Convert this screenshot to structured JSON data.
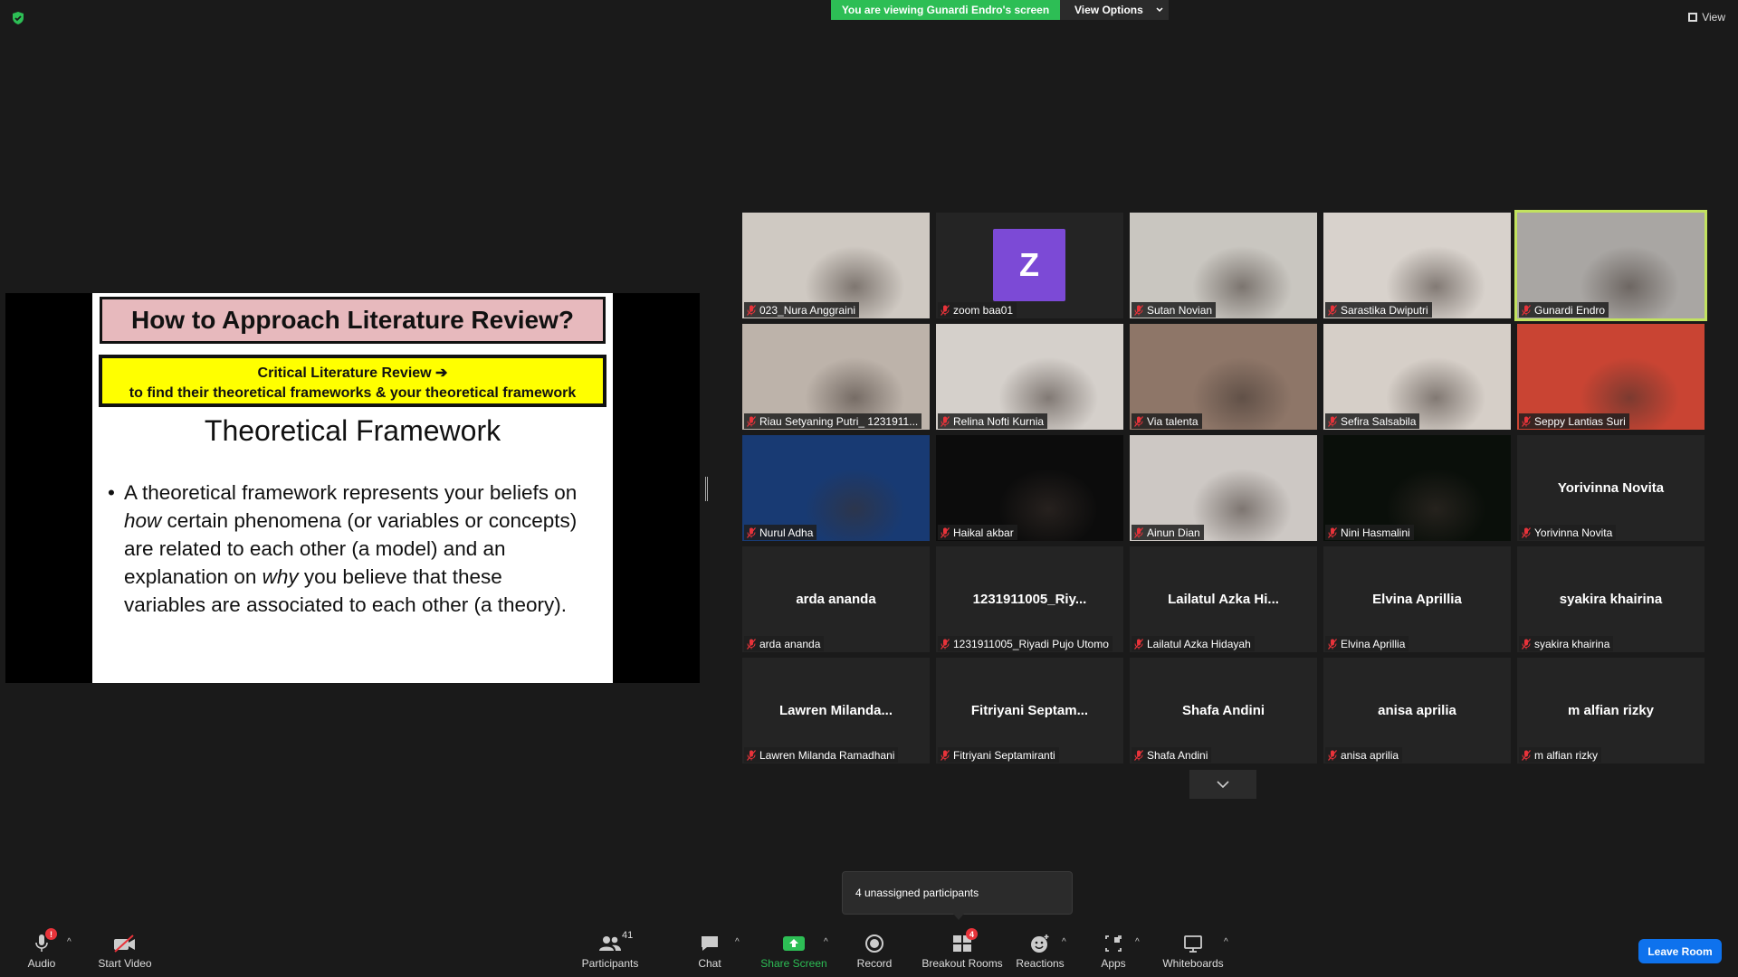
{
  "banner": {
    "viewing_text": "You are viewing Gunardi Endro's screen",
    "view_options": "View Options",
    "view_label": "View"
  },
  "slide": {
    "title": "How to Approach Literature Review?",
    "box_line1": "Critical Literature Review ➔",
    "box_line2": "to find their theoretical frameworks & your theoretical framework",
    "subtitle": "Theoretical Framework",
    "bullet_part1": "A theoretical framework represents your beliefs on ",
    "bullet_em1": "how",
    "bullet_part2": " certain phenomena (or variables or concepts) are related to each other (a model) and an explanation on ",
    "bullet_em2": "why",
    "bullet_part3": " you believe that these variables are associated to each other (a theory)."
  },
  "participants": [
    {
      "name": "023_Nura Anggraini",
      "type": "video",
      "color": "#cfc9c2"
    },
    {
      "name": "zoom baa01",
      "type": "avatar",
      "avatar_letter": "Z"
    },
    {
      "name": "Sutan Novian",
      "type": "video",
      "color": "#c9c6c0"
    },
    {
      "name": "Sarastika Dwiputri",
      "type": "video",
      "color": "#d8d2cc"
    },
    {
      "name": "Gunardi Endro",
      "type": "video",
      "color": "#a9a6a3",
      "active": true
    },
    {
      "name": "Riau Setyaning Putri_ 1231911...",
      "type": "video",
      "color": "#bdb3aa"
    },
    {
      "name": "Relina Nofti Kurnia",
      "type": "video",
      "color": "#d5d0cb"
    },
    {
      "name": "Via talenta",
      "type": "video",
      "color": "#8e7668"
    },
    {
      "name": "Sefira Salsabila",
      "type": "video",
      "color": "#d6cfc8"
    },
    {
      "name": "Seppy Lantias Suri",
      "type": "video",
      "color": "#c94433"
    },
    {
      "name": "Nurul Adha",
      "type": "video",
      "color": "#183a73"
    },
    {
      "name": "Haikal akbar",
      "type": "video",
      "color": "#0c0c0c"
    },
    {
      "name": "Ainun Dian",
      "type": "video",
      "color": "#cdc8c4"
    },
    {
      "name": "Nini Hasmalini",
      "type": "video",
      "color": "#0a0f0a"
    },
    {
      "name": "Yorivinna Novita",
      "type": "name",
      "big_name": "Yorivinna Novita"
    },
    {
      "name": "arda ananda",
      "type": "name",
      "big_name": "arda ananda"
    },
    {
      "name": "1231911005_Riyadi Pujo Utomo",
      "type": "name",
      "big_name": "1231911005_Riy..."
    },
    {
      "name": "Lailatul Azka Hidayah",
      "type": "name",
      "big_name": "Lailatul  Azka  Hi..."
    },
    {
      "name": "Elvina Aprillia",
      "type": "name",
      "big_name": "Elvina Aprillia"
    },
    {
      "name": "syakira khairina",
      "type": "name",
      "big_name": "syakira khairina"
    },
    {
      "name": "Lawren Milanda Ramadhani",
      "type": "name",
      "big_name": "Lawren  Milanda..."
    },
    {
      "name": "Fitriyani Septamiranti",
      "type": "name",
      "big_name": "Fitriyani  Septam..."
    },
    {
      "name": "Shafa Andini",
      "type": "name",
      "big_name": "Shafa Andini"
    },
    {
      "name": "anisa aprilia",
      "type": "name",
      "big_name": "anisa aprilia"
    },
    {
      "name": "m alfian rizky",
      "type": "name",
      "big_name": "m alfian rizky"
    }
  ],
  "tooltip": {
    "text": "4 unassigned participants"
  },
  "toolbar": {
    "audio": "Audio",
    "audio_badge": "!",
    "start_video": "Start Video",
    "participants": "Participants",
    "participants_count": "41",
    "chat": "Chat",
    "share_screen": "Share Screen",
    "record": "Record",
    "breakout_rooms": "Breakout Rooms",
    "breakout_badge": "4",
    "reactions": "Reactions",
    "apps": "Apps",
    "whiteboards": "Whiteboards",
    "leave_room": "Leave Room"
  },
  "colors": {
    "accent_green": "#2dbe55",
    "leave_blue": "#0e72ed",
    "active_border": "#c2e25f",
    "mute_red": "#e8333a"
  }
}
